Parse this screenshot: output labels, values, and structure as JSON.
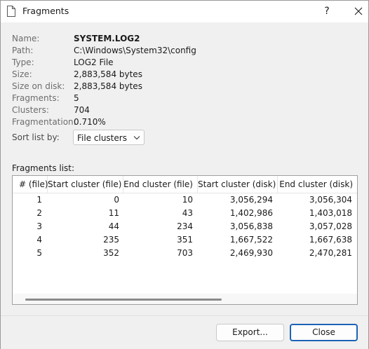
{
  "window": {
    "title": "Fragments",
    "help_glyph": "?",
    "close_icon": "close-icon"
  },
  "properties": [
    {
      "label": "Name:",
      "value": "SYSTEM.LOG2",
      "bold": true
    },
    {
      "label": "Path:",
      "value": "C:\\Windows\\System32\\config"
    },
    {
      "label": "Type:",
      "value": "LOG2 File"
    },
    {
      "label": "Size:",
      "value": "2,883,584 bytes"
    },
    {
      "label": "Size on disk:",
      "value": "2,883,584 bytes"
    },
    {
      "label": "Fragments:",
      "value": "5"
    },
    {
      "label": "Clusters:",
      "value": "704"
    },
    {
      "label": "Fragmentation:",
      "value": "0.710%"
    }
  ],
  "sort": {
    "label": "Sort list by:",
    "selected": "File clusters"
  },
  "fragments_list": {
    "label": "Fragments list:",
    "columns": [
      "# (file)",
      "Start cluster (file)",
      "End cluster (file)",
      "Start cluster (disk)",
      "End cluster (disk)"
    ],
    "rows": [
      [
        "1",
        "0",
        "10",
        "3,056,294",
        "3,056,304"
      ],
      [
        "2",
        "11",
        "43",
        "1,402,986",
        "1,403,018"
      ],
      [
        "3",
        "44",
        "234",
        "3,056,838",
        "3,057,028"
      ],
      [
        "4",
        "235",
        "351",
        "1,667,522",
        "1,667,638"
      ],
      [
        "5",
        "352",
        "703",
        "2,469,930",
        "2,470,281"
      ]
    ]
  },
  "buttons": {
    "export": "Export...",
    "close": "Close"
  },
  "colors": {
    "accent": "#1d63b5",
    "label_gray": "#6d6d6d",
    "background": "#f0f0f0"
  }
}
